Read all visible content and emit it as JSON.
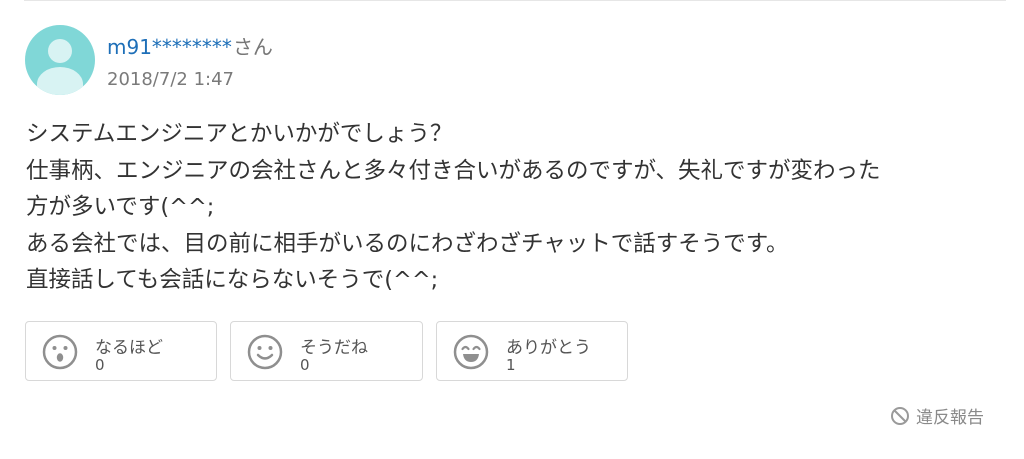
{
  "user": {
    "name": "m91********",
    "suffix": "さん",
    "posted_at": "2018/7/2 1:47"
  },
  "post": {
    "lines": [
      "システムエンジニアとかいかがでしょう？",
      "仕事柄、エンジニアの会社さんと多々付き合いがあるのですが、失礼ですが変わった",
      "方が多いです(^^;",
      "ある会社では、目の前に相手がいるのにわざわざチャットで話すそうです。",
      "直接話しても会話にならないそうで(^^;"
    ]
  },
  "reactions": [
    {
      "label": "なるほど",
      "count": "0",
      "icon": "surprised-face-icon"
    },
    {
      "label": "そうだね",
      "count": "0",
      "icon": "smile-face-icon"
    },
    {
      "label": "ありがとう",
      "count": "1",
      "icon": "grin-face-icon"
    }
  ],
  "report": {
    "label": "違反報告",
    "icon": "prohibited-icon"
  },
  "colors": {
    "username": "#1e6fb8",
    "avatar": "#80d7d7",
    "text": "#333333",
    "muted": "#7a7a7a",
    "border": "#d8d8d8"
  }
}
